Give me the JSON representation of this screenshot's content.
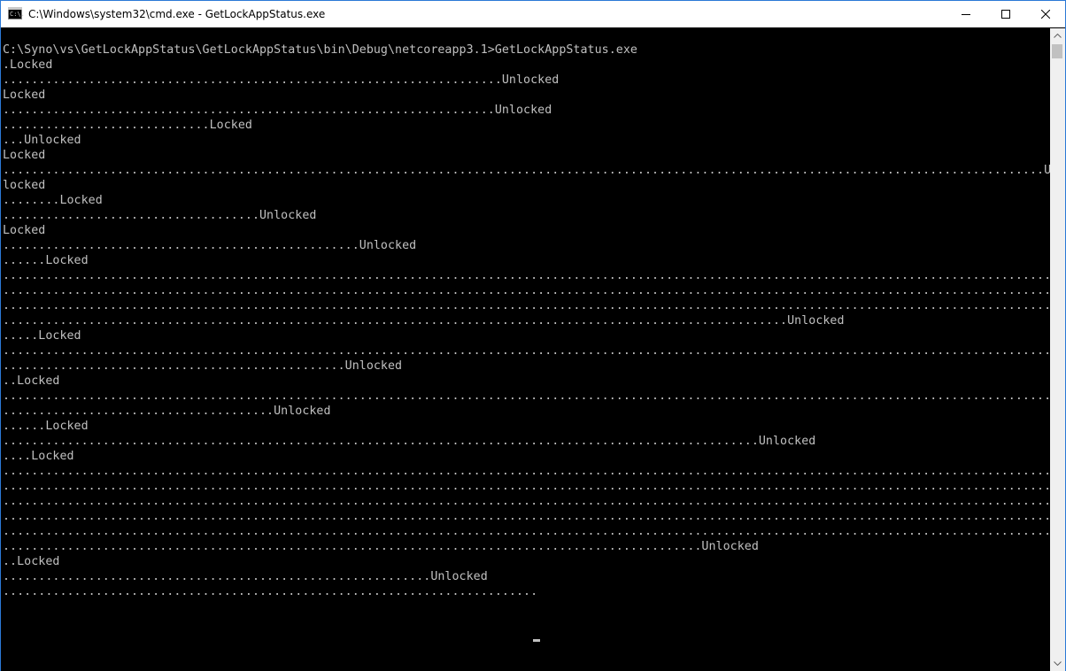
{
  "window": {
    "title": "C:\\Windows\\system32\\cmd.exe - GetLockAppStatus.exe",
    "icon_text": "C:\\."
  },
  "console": {
    "lines": [
      "C:\\Syno\\vs\\GetLockAppStatus\\GetLockAppStatus\\bin\\Debug\\netcoreapp3.1>GetLockAppStatus.exe",
      ".Locked",
      "......................................................................Unlocked",
      "Locked",
      ".....................................................................Unlocked",
      ".............................Locked",
      "...Unlocked",
      "Locked",
      "..................................................................................................................................................Un",
      "locked",
      "........Locked",
      "....................................Unlocked",
      "Locked",
      "..................................................Unlocked",
      "......Locked",
      "..................................................................................................................................................................",
      "..................................................................................................................................................................",
      "..................................................................................................................................................................",
      "..............................................................................................................Unlocked",
      ".....Locked",
      "..................................................................................................................................................................",
      "................................................Unlocked",
      "..Locked",
      "..................................................................................................................................................................",
      "......................................Unlocked",
      "......Locked",
      "..........................................................................................................Unlocked",
      "....Locked",
      "..................................................................................................................................................................",
      "..................................................................................................................................................................",
      "..................................................................................................................................................................",
      "..................................................................................................................................................................",
      "..................................................................................................................................................................",
      "..................................................................................................Unlocked",
      "..Locked",
      "............................................................Unlocked",
      "..........................................................................."
    ]
  },
  "colors": {
    "console_bg": "#000000",
    "console_fg": "#c0c0c0",
    "accent_border": "#2b79d6"
  },
  "icons": {
    "minimize": "minimize-icon",
    "maximize": "maximize-icon",
    "close": "close-icon"
  }
}
